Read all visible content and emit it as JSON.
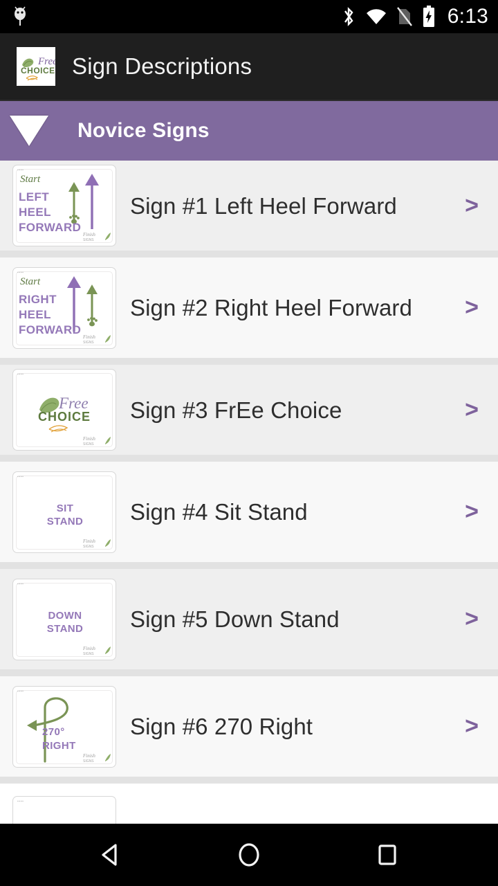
{
  "statusbar": {
    "time": "6:13",
    "icons": [
      "android-notification-icon",
      "bluetooth-icon",
      "wifi-icon",
      "no-sim-icon",
      "battery-charging-icon"
    ]
  },
  "appbar": {
    "title": "Sign Descriptions",
    "logo_alt": "FrEe Choice logo",
    "logo_line1": "Free",
    "logo_line2": "CHOICE",
    "background": "#1f1f1f"
  },
  "group": {
    "title": "Novice Signs",
    "expanded": true,
    "accent": "#806a9e",
    "indicator": "triangle-down-icon"
  },
  "list": {
    "chevron": ">",
    "items": [
      {
        "label": "Sign #1 Left Heel Forward",
        "thumb": {
          "script": "Start",
          "lines": [
            "LEFT",
            "HEEL",
            "FORWARD"
          ],
          "kind": "heel-forward-left"
        }
      },
      {
        "label": "Sign #2 Right Heel Forward",
        "thumb": {
          "script": "Start",
          "lines": [
            "RIGHT",
            "HEEL",
            "FORWARD"
          ],
          "kind": "heel-forward-right"
        }
      },
      {
        "label": "Sign #3 FrEe Choice",
        "thumb": {
          "script": "",
          "lines": [
            "Free",
            "CHOICE"
          ],
          "kind": "logo"
        }
      },
      {
        "label": "Sign #4 Sit Stand",
        "thumb": {
          "script": "",
          "lines": [
            "SIT",
            "STAND"
          ],
          "kind": "text-only"
        }
      },
      {
        "label": "Sign #5 Down Stand",
        "thumb": {
          "script": "",
          "lines": [
            "DOWN",
            "STAND"
          ],
          "kind": "text-only"
        }
      },
      {
        "label": "Sign #6 270 Right",
        "thumb": {
          "script": "",
          "lines": [
            "270°",
            "RIGHT"
          ],
          "kind": "loop-270-right"
        }
      }
    ]
  },
  "navbar": {
    "back": "back-triangle-icon",
    "home": "home-circle-icon",
    "recents": "recents-square-icon"
  },
  "colors": {
    "purple_accent": "#806a9e",
    "sign_text_purple": "#9478b8",
    "green": "#7a9455",
    "row_bg": "#efefef",
    "row_bg_alt": "#f8f8f8",
    "divider": "#e2e2e2",
    "label_text": "#2e2e2e"
  }
}
